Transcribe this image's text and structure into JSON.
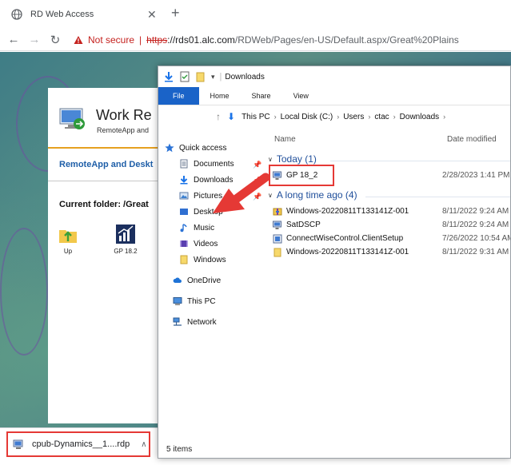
{
  "browser": {
    "tab_title": "RD Web Access",
    "security_label": "Not secure",
    "url_scheme": "https",
    "url_host": "://rds01.alc.com",
    "url_path": "/RDWeb/Pages/en-US/Default.aspx/Great%20Plains"
  },
  "rdweb": {
    "title": "Work Re",
    "subtitle": "RemoteApp and",
    "nav_label": "RemoteApp and Deskt",
    "current_folder": "Current folder: /Great",
    "apps": [
      {
        "label": "Up",
        "icon": "folder-up-icon"
      },
      {
        "label": "GP 18.2",
        "icon": "chart-app-icon"
      }
    ]
  },
  "download": {
    "filename": "cpub-Dynamics__1....rdp"
  },
  "explorer": {
    "title": "Downloads",
    "ribbon_tabs": [
      "File",
      "Home",
      "Share",
      "View"
    ],
    "breadcrumb": [
      "This PC",
      "Local Disk (C:)",
      "Users",
      "ctac",
      "Downloads"
    ],
    "nav": [
      {
        "label": "Quick access",
        "icon": "star-icon",
        "pinned": false
      },
      {
        "label": "Documents",
        "icon": "documents-icon",
        "pinned": true
      },
      {
        "label": "Downloads",
        "icon": "download-arrow-icon",
        "pinned": true
      },
      {
        "label": "Pictures",
        "icon": "pictures-icon",
        "pinned": true
      },
      {
        "label": "Desktop",
        "icon": "desktop-icon",
        "pinned": false
      },
      {
        "label": "Music",
        "icon": "music-icon",
        "pinned": false
      },
      {
        "label": "Videos",
        "icon": "videos-icon",
        "pinned": false
      },
      {
        "label": "Windows",
        "icon": "folder-icon",
        "pinned": false
      },
      {
        "label": "OneDrive",
        "icon": "cloud-icon",
        "pinned": false
      },
      {
        "label": "This PC",
        "icon": "computer-icon",
        "pinned": false
      },
      {
        "label": "Network",
        "icon": "network-icon",
        "pinned": false
      }
    ],
    "columns": {
      "name": "Name",
      "date": "Date modified"
    },
    "groups": [
      {
        "label": "Today (1)",
        "files": [
          {
            "name": "GP 18_2",
            "date": "2/28/2023 1:41 PM",
            "icon": "rdp-file-icon"
          }
        ]
      },
      {
        "label": "A long time ago (4)",
        "files": [
          {
            "name": "Windows-20220811T133141Z-001",
            "date": "8/11/2022 9:24 AM",
            "icon": "zip-archive-icon"
          },
          {
            "name": "SatDSCP",
            "date": "8/11/2022 9:24 AM",
            "icon": "rdp-file-icon"
          },
          {
            "name": "ConnectWiseControl.ClientSetup",
            "date": "7/26/2022 10:54 AM",
            "icon": "installer-icon"
          },
          {
            "name": "Windows-20220811T133141Z-001",
            "date": "8/11/2022 9:31 AM",
            "icon": "folder-icon"
          }
        ]
      }
    ],
    "status": "5 items"
  },
  "colors": {
    "highlight": "#e53935",
    "file_tab": "#1a63c8",
    "group_text": "#1f4e9a"
  }
}
